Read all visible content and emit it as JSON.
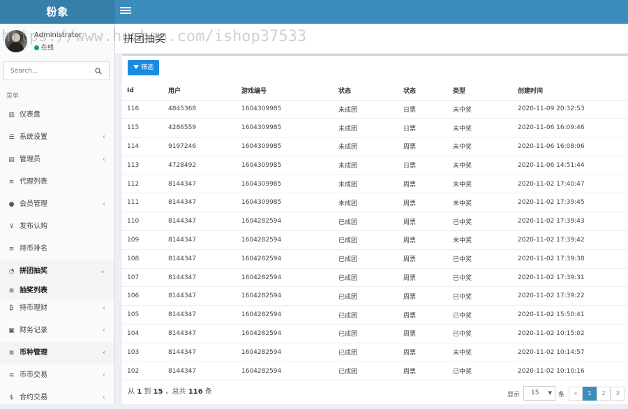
{
  "header": {
    "logo": "粉象"
  },
  "user": {
    "name": "Administrator",
    "status": "在线"
  },
  "search": {
    "placeholder": "Search..."
  },
  "sidebar": {
    "header": "菜单",
    "items": [
      {
        "label": "仪表盘",
        "icon": "bar-chart-icon"
      },
      {
        "label": "系统设置",
        "icon": "sliders-icon"
      },
      {
        "label": "管理员",
        "icon": "id-card-icon"
      },
      {
        "label": "代理列表",
        "icon": "list-icon"
      },
      {
        "label": "会员管理",
        "icon": "users-icon"
      },
      {
        "label": "发布认购",
        "icon": "cart-icon"
      },
      {
        "label": "持币排名",
        "icon": "list-icon"
      },
      {
        "label": "拼团抽奖",
        "icon": "dashboard-icon"
      },
      {
        "label": "抽奖列表",
        "icon": "list-icon"
      },
      {
        "label": "持币理财",
        "icon": "bitcoin-icon"
      },
      {
        "label": "财务记录",
        "icon": "money-icon"
      },
      {
        "label": "币种管理",
        "icon": "list-icon"
      },
      {
        "label": "币币交易",
        "icon": "list-icon"
      },
      {
        "label": "合约交易",
        "icon": "dollar-icon"
      }
    ]
  },
  "watermark": "https://www.huzhan.com/ishop37533",
  "page": {
    "title": "拼团抽奖"
  },
  "toolbar": {
    "filter_label": "筛选"
  },
  "table": {
    "columns": [
      "Id",
      "用户",
      "游戏编号",
      "状态",
      "状态",
      "类型",
      "创建时间"
    ],
    "rows": [
      [
        "116",
        "4845368",
        "1604309985",
        "未成团",
        "日票",
        "未中奖",
        "2020-11-09 20:32:53"
      ],
      [
        "115",
        "4286559",
        "1604309985",
        "未成团",
        "日票",
        "未中奖",
        "2020-11-06 16:09:46"
      ],
      [
        "114",
        "9197246",
        "1604309985",
        "未成团",
        "周票",
        "未中奖",
        "2020-11-06 16:08:06"
      ],
      [
        "113",
        "4728492",
        "1604309985",
        "未成团",
        "日票",
        "未中奖",
        "2020-11-06 14:51:44"
      ],
      [
        "112",
        "8144347",
        "1604309985",
        "未成团",
        "周票",
        "未中奖",
        "2020-11-02 17:40:47"
      ],
      [
        "111",
        "8144347",
        "1604309985",
        "未成团",
        "周票",
        "未中奖",
        "2020-11-02 17:39:45"
      ],
      [
        "110",
        "8144347",
        "1604282594",
        "已成团",
        "周票",
        "已中奖",
        "2020-11-02 17:39:43"
      ],
      [
        "109",
        "8144347",
        "1604282594",
        "已成团",
        "周票",
        "未中奖",
        "2020-11-02 17:39:42"
      ],
      [
        "108",
        "8144347",
        "1604282594",
        "已成团",
        "周票",
        "已中奖",
        "2020-11-02 17:39:38"
      ],
      [
        "107",
        "8144347",
        "1604282594",
        "已成团",
        "周票",
        "已中奖",
        "2020-11-02 17:39:31"
      ],
      [
        "106",
        "8144347",
        "1604282594",
        "已成团",
        "周票",
        "已中奖",
        "2020-11-02 17:39:22"
      ],
      [
        "105",
        "8144347",
        "1604282594",
        "已成团",
        "周票",
        "已中奖",
        "2020-11-02 15:50:41"
      ],
      [
        "104",
        "8144347",
        "1604282594",
        "已成团",
        "周票",
        "已中奖",
        "2020-11-02 10:15:02"
      ],
      [
        "103",
        "8144347",
        "1604282594",
        "已成团",
        "周票",
        "未中奖",
        "2020-11-02 10:14:57"
      ],
      [
        "102",
        "8144347",
        "1604282594",
        "已成团",
        "周票",
        "已中奖",
        "2020-11-02 10:10:16"
      ]
    ]
  },
  "pagination": {
    "info_from": "从",
    "start": "1",
    "to": "到",
    "end": "15",
    "total_prefix": "，总共",
    "total": "116",
    "unit": "条",
    "show_label": "显示",
    "page_size": "15",
    "page_unit": "条",
    "prev": "«",
    "pages": [
      "1",
      "2",
      "3"
    ],
    "current": "1"
  },
  "colors": {
    "topbar": "#3c8dbc",
    "logo_bg": "#367fa9",
    "filter_button": "#1a8ce0",
    "online": "#00a65a"
  }
}
